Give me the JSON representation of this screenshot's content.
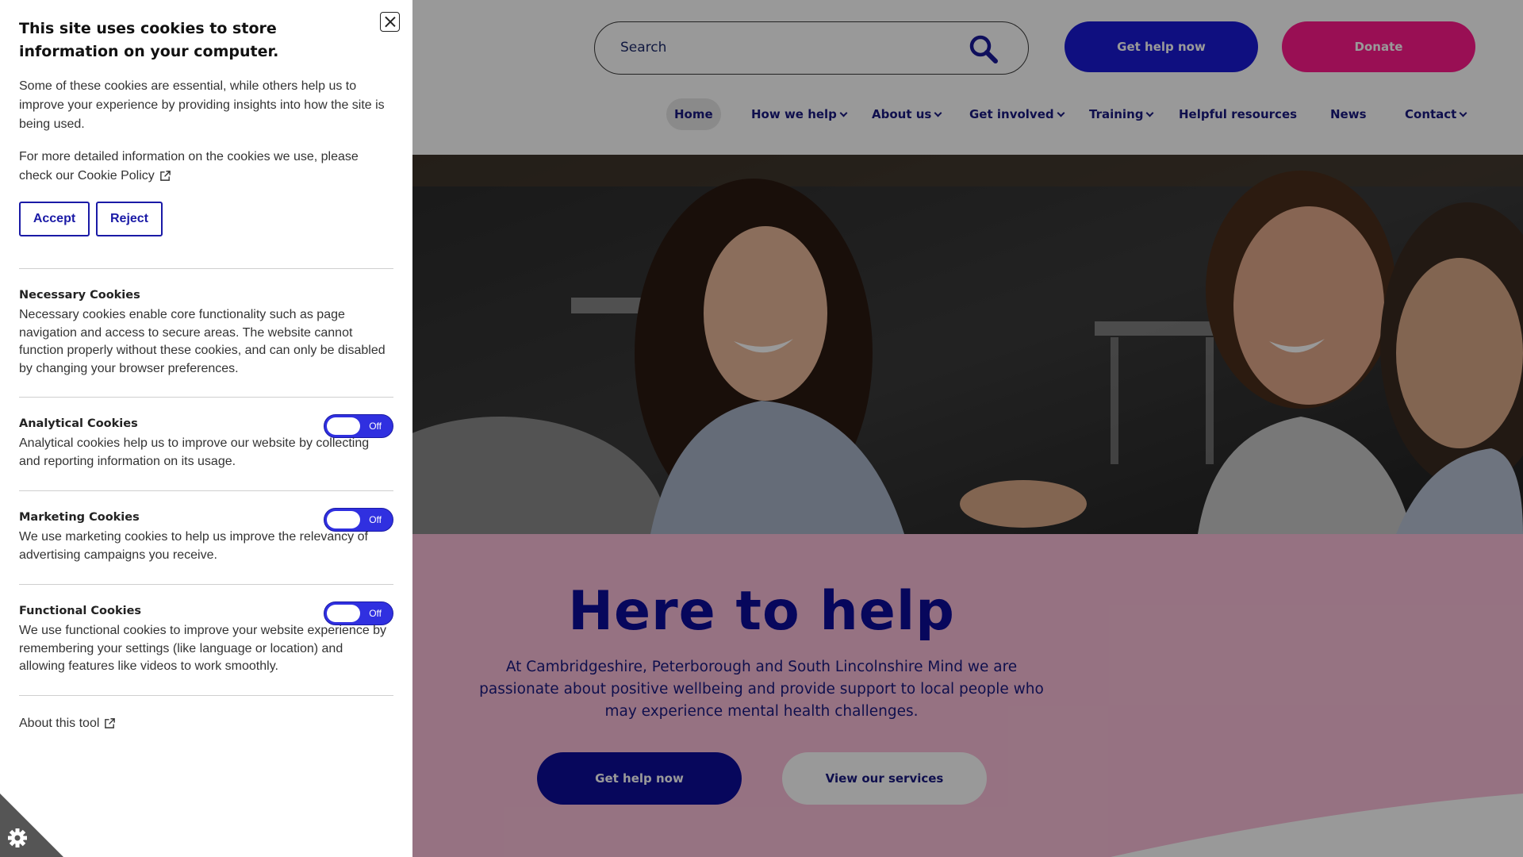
{
  "site": {
    "search": {
      "placeholder": "Search"
    },
    "header_buttons": {
      "help": "Get help now",
      "donate": "Donate"
    },
    "nav": [
      {
        "label": "Home",
        "active": true,
        "dropdown": false
      },
      {
        "label": "How we help",
        "active": false,
        "dropdown": true
      },
      {
        "label": "About us",
        "active": false,
        "dropdown": true
      },
      {
        "label": "Get involved",
        "active": false,
        "dropdown": true
      },
      {
        "label": "Training",
        "active": false,
        "dropdown": true
      },
      {
        "label": "Helpful resources",
        "active": false,
        "dropdown": false
      },
      {
        "label": "News",
        "active": false,
        "dropdown": false
      },
      {
        "label": "Contact",
        "active": false,
        "dropdown": true
      }
    ],
    "hero": {
      "headline": "Here to help",
      "subtext": "At Cambridgeshire, Peterborough and South Lincolnshire Mind we are passionate about positive wellbeing and provide support to local people who may experience mental health challenges.",
      "cta_help": "Get help now",
      "cta_services": "View our services"
    },
    "colors": {
      "brand_blue": "#0c0c9a",
      "brand_pink": "#ff1a8c",
      "band_pink": "#fabfd9"
    }
  },
  "cookie_panel": {
    "title": "This site uses cookies to store information on your computer.",
    "intro": "Some of these cookies are essential, while others help us to improve your experience by providing insights into how the site is being used.",
    "policy_text": "For more detailed information on the cookies we use, please check our Cookie Policy",
    "accept_label": "Accept",
    "reject_label": "Reject",
    "sections": {
      "necessary": {
        "title": "Necessary Cookies",
        "text": "Necessary cookies enable core functionality such as page navigation and access to secure areas. The website cannot function properly without these cookies, and can only be disabled by changing your browser preferences."
      },
      "analytical": {
        "title": "Analytical Cookies",
        "text": "Analytical cookies help us to improve our website by collecting and reporting information on its usage.",
        "toggle": "Off"
      },
      "marketing": {
        "title": "Marketing Cookies",
        "text": "We use marketing cookies to help us improve the relevancy of advertising campaigns you receive.",
        "toggle": "Off"
      },
      "functional": {
        "title": "Functional Cookies",
        "text": "We use functional cookies to improve your website experience by remembering your settings (like language or location) and allowing features like videos to work smoothly.",
        "toggle": "Off"
      }
    },
    "about_tool": "About this tool"
  }
}
